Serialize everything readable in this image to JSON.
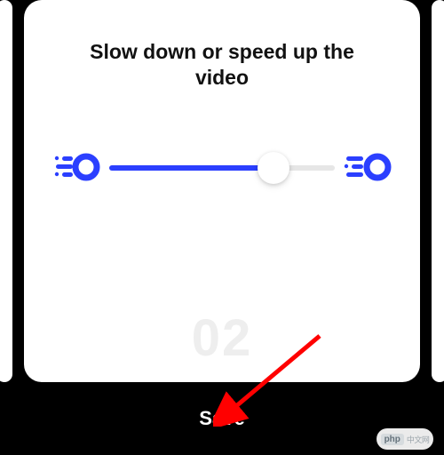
{
  "card": {
    "title": "Slow down or speed up the video",
    "step_number": "02",
    "slider": {
      "value_pct": 73
    }
  },
  "actions": {
    "save_label": "Save"
  },
  "watermark": {
    "brand": "php",
    "suffix": "中文网"
  },
  "colors": {
    "accent": "#2b3fff",
    "annotation": "#ff0000"
  }
}
